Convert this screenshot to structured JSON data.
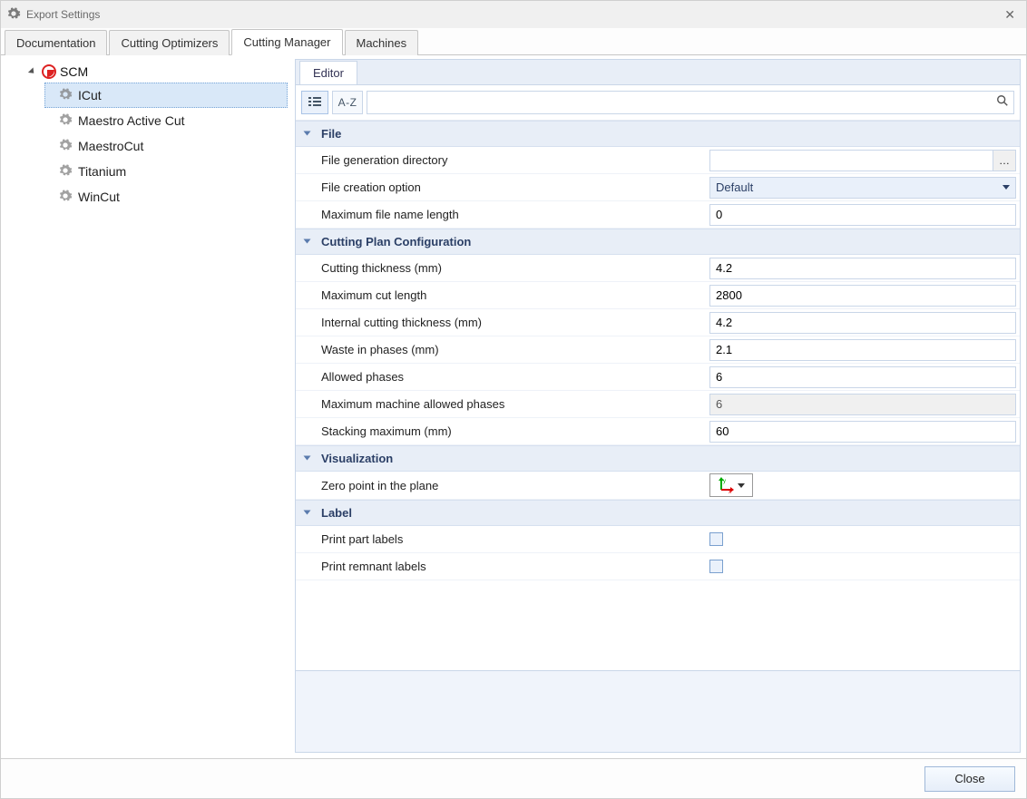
{
  "window": {
    "title": "Export Settings"
  },
  "tabs": [
    {
      "label": "Documentation"
    },
    {
      "label": "Cutting Optimizers"
    },
    {
      "label": "Cutting Manager",
      "active": true
    },
    {
      "label": "Machines"
    }
  ],
  "tree": {
    "root_label": "SCM",
    "items": [
      {
        "label": "ICut",
        "selected": true
      },
      {
        "label": "Maestro Active Cut"
      },
      {
        "label": "MaestroCut"
      },
      {
        "label": "Titanium"
      },
      {
        "label": "WinCut"
      }
    ]
  },
  "editor": {
    "tab_label": "Editor",
    "toolbar": {
      "az_label": "A-Z",
      "search_placeholder": ""
    },
    "groups": {
      "file": {
        "title": "File",
        "dir_label": "File generation directory",
        "dir_value": "",
        "opt_label": "File creation option",
        "opt_value": "Default",
        "maxname_label": "Maximum file name length",
        "maxname_value": "0"
      },
      "cpc": {
        "title": "Cutting Plan Configuration",
        "ct_label": "Cutting thickness (mm)",
        "ct_value": "4.2",
        "mcl_label": "Maximum cut length",
        "mcl_value": "2800",
        "ict_label": "Internal cutting thickness (mm)",
        "ict_value": "4.2",
        "wip_label": "Waste in phases (mm)",
        "wip_value": "2.1",
        "ap_label": "Allowed phases",
        "ap_value": "6",
        "mmap_label": "Maximum machine allowed phases",
        "mmap_value": "6",
        "sm_label": "Stacking maximum (mm)",
        "sm_value": "60"
      },
      "viz": {
        "title": "Visualization",
        "zp_label": "Zero point in the plane"
      },
      "label": {
        "title": "Label",
        "ppl_label": "Print part labels",
        "prl_label": "Print remnant labels"
      }
    }
  },
  "footer": {
    "close_label": "Close"
  }
}
